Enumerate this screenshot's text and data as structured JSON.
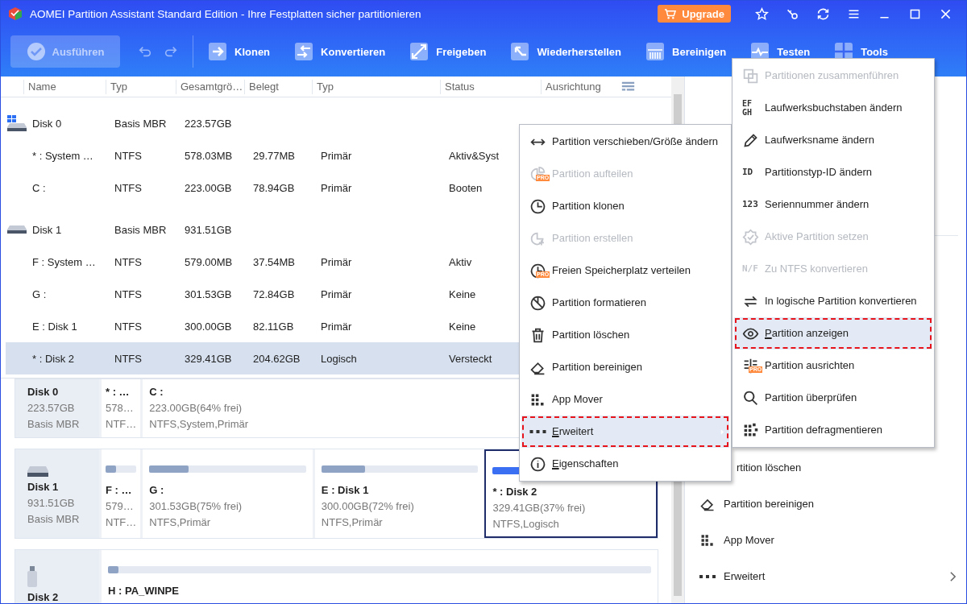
{
  "window": {
    "title": "AOMEI Partition Assistant  Standard Edition - Ihre Festplatten sicher partitionieren",
    "upgrade": "Upgrade"
  },
  "toolbar": {
    "apply": {
      "label": "Ausführen",
      "disabled": true
    },
    "tools": [
      "Klonen",
      "Konvertieren",
      "Freigeben",
      "Wiederherstellen",
      "Bereinigen",
      "Testen",
      "Tools"
    ]
  },
  "table": {
    "columns": [
      "Name",
      "Typ",
      "Gesamtgrö…",
      "Belegt",
      "Typ",
      "Status",
      "Ausrichtung"
    ],
    "rows": [
      {
        "kind": "disk",
        "cells": [
          "Disk 0",
          "Basis MBR",
          "223.57GB"
        ],
        "selected": false
      },
      {
        "kind": "partition",
        "cells": [
          "* : System …",
          "NTFS",
          "578.03MB",
          "29.77MB",
          "Primär",
          "Aktiv&Syst"
        ],
        "selected": false
      },
      {
        "kind": "partition",
        "cells": [
          "C :",
          "NTFS",
          "223.00GB",
          "78.94GB",
          "Primär",
          "Booten"
        ],
        "selected": false
      },
      {
        "kind": "disk",
        "cells": [
          "Disk 1",
          "Basis MBR",
          "931.51GB"
        ],
        "selected": false
      },
      {
        "kind": "partition",
        "cells": [
          "F : System …",
          "NTFS",
          "579.00MB",
          "37.54MB",
          "Primär",
          "Aktiv"
        ],
        "selected": false
      },
      {
        "kind": "partition",
        "cells": [
          "G :",
          "NTFS",
          "301.53GB",
          "72.84GB",
          "Primär",
          "Keine"
        ],
        "selected": false
      },
      {
        "kind": "partition",
        "cells": [
          "E : Disk 1",
          "NTFS",
          "300.00GB",
          "82.11GB",
          "Primär",
          "Keine"
        ],
        "selected": false
      },
      {
        "kind": "partition",
        "cells": [
          "* : Disk 2",
          "NTFS",
          "329.41GB",
          "204.62GB",
          "Logisch",
          "Versteckt"
        ],
        "selected": true
      }
    ]
  },
  "disk_map": [
    {
      "name": "Disk 0",
      "size": "223.57GB",
      "type": "Basis MBR",
      "partitions": [
        {
          "label": "* : …",
          "size": "578…",
          "fs": "NTF…",
          "selected": false
        },
        {
          "label": "C :",
          "size": "223.00GB(64% frei)",
          "fs": "NTFS,System,Primär",
          "selected": false
        }
      ]
    },
    {
      "name": "Disk 1",
      "size": "931.51GB",
      "type": "Basis MBR",
      "partitions": [
        {
          "label": "F : …",
          "size": "579…",
          "fs": "NTF…",
          "level": 0.35,
          "selected": false
        },
        {
          "label": "G :",
          "size": "301.53GB(75% frei)",
          "fs": "NTFS,Primär",
          "level": 0.25,
          "selected": false
        },
        {
          "label": "E : Disk 1",
          "size": "300.00GB(72% frei)",
          "fs": "NTFS,Primär",
          "level": 0.28,
          "selected": false
        },
        {
          "label": "* : Disk 2",
          "size": "329.41GB(37% frei)",
          "fs": "NTFS,Logisch",
          "level": 0.63,
          "selected": true
        }
      ]
    },
    {
      "name": "Disk 2",
      "partitions": [
        {
          "label": "H : PA_WINPE",
          "level": 0.02,
          "selected": false
        }
      ]
    }
  ],
  "context_menu": [
    {
      "label": "Partition verschieben/Größe ändern",
      "disabled": false,
      "selected": false
    },
    {
      "label": "Partition aufteilen",
      "badge": "PRO",
      "disabled": true,
      "selected": false
    },
    {
      "label": "Partition klonen",
      "disabled": false,
      "selected": false
    },
    {
      "label": "Partition erstellen",
      "disabled": true,
      "selected": false
    },
    {
      "label": "Freien Speicherplatz verteilen",
      "badge": "PRO",
      "disabled": false,
      "selected": false
    },
    {
      "label": "Partition formatieren",
      "disabled": false,
      "selected": false
    },
    {
      "label": "Partition löschen",
      "disabled": false,
      "selected": false
    },
    {
      "label": "Partition bereinigen",
      "disabled": false,
      "selected": false
    },
    {
      "label": "App Mover",
      "disabled": false,
      "selected": false
    },
    {
      "label": "Erweitert",
      "mnemonic": true,
      "submenu": true,
      "disabled": false,
      "selected": true
    },
    {
      "label": "Eigenschaften",
      "mnemonic": true,
      "disabled": false,
      "selected": false
    }
  ],
  "submenu": [
    {
      "label": "Partitionen zusammenführen",
      "disabled": true,
      "selected": false
    },
    {
      "label": "Laufwerksbuchstaben ändern",
      "glyph": "EFGH",
      "disabled": false,
      "selected": false
    },
    {
      "label": "Laufwerksname ändern",
      "disabled": false,
      "selected": false
    },
    {
      "label": "Partitionstyp-ID ändern",
      "glyph": "ID",
      "disabled": false,
      "selected": false
    },
    {
      "label": "Seriennummer ändern",
      "glyph": "123",
      "disabled": false,
      "selected": false
    },
    {
      "label": "Aktive Partition setzen",
      "disabled": true,
      "selected": false
    },
    {
      "label": "Zu NTFS konvertieren",
      "glyph": "N/F",
      "disabled": true,
      "selected": false
    },
    {
      "label": "In logische Partition konvertieren",
      "disabled": false,
      "selected": false
    },
    {
      "label": "Partition anzeigen",
      "mnemonic": true,
      "disabled": false,
      "selected": true
    },
    {
      "label": "Partition ausrichten",
      "badge": "PRO",
      "disabled": false,
      "selected": false
    },
    {
      "label": "Partition überprüfen",
      "disabled": false,
      "selected": false
    },
    {
      "label": "Partition defragmentieren",
      "disabled": false,
      "selected": false
    }
  ],
  "side_panel": [
    {
      "label": "rtition löschen"
    },
    {
      "label": "Partition bereinigen"
    },
    {
      "label": "App Mover"
    },
    {
      "label": "Erweitert",
      "submenu": true
    }
  ]
}
